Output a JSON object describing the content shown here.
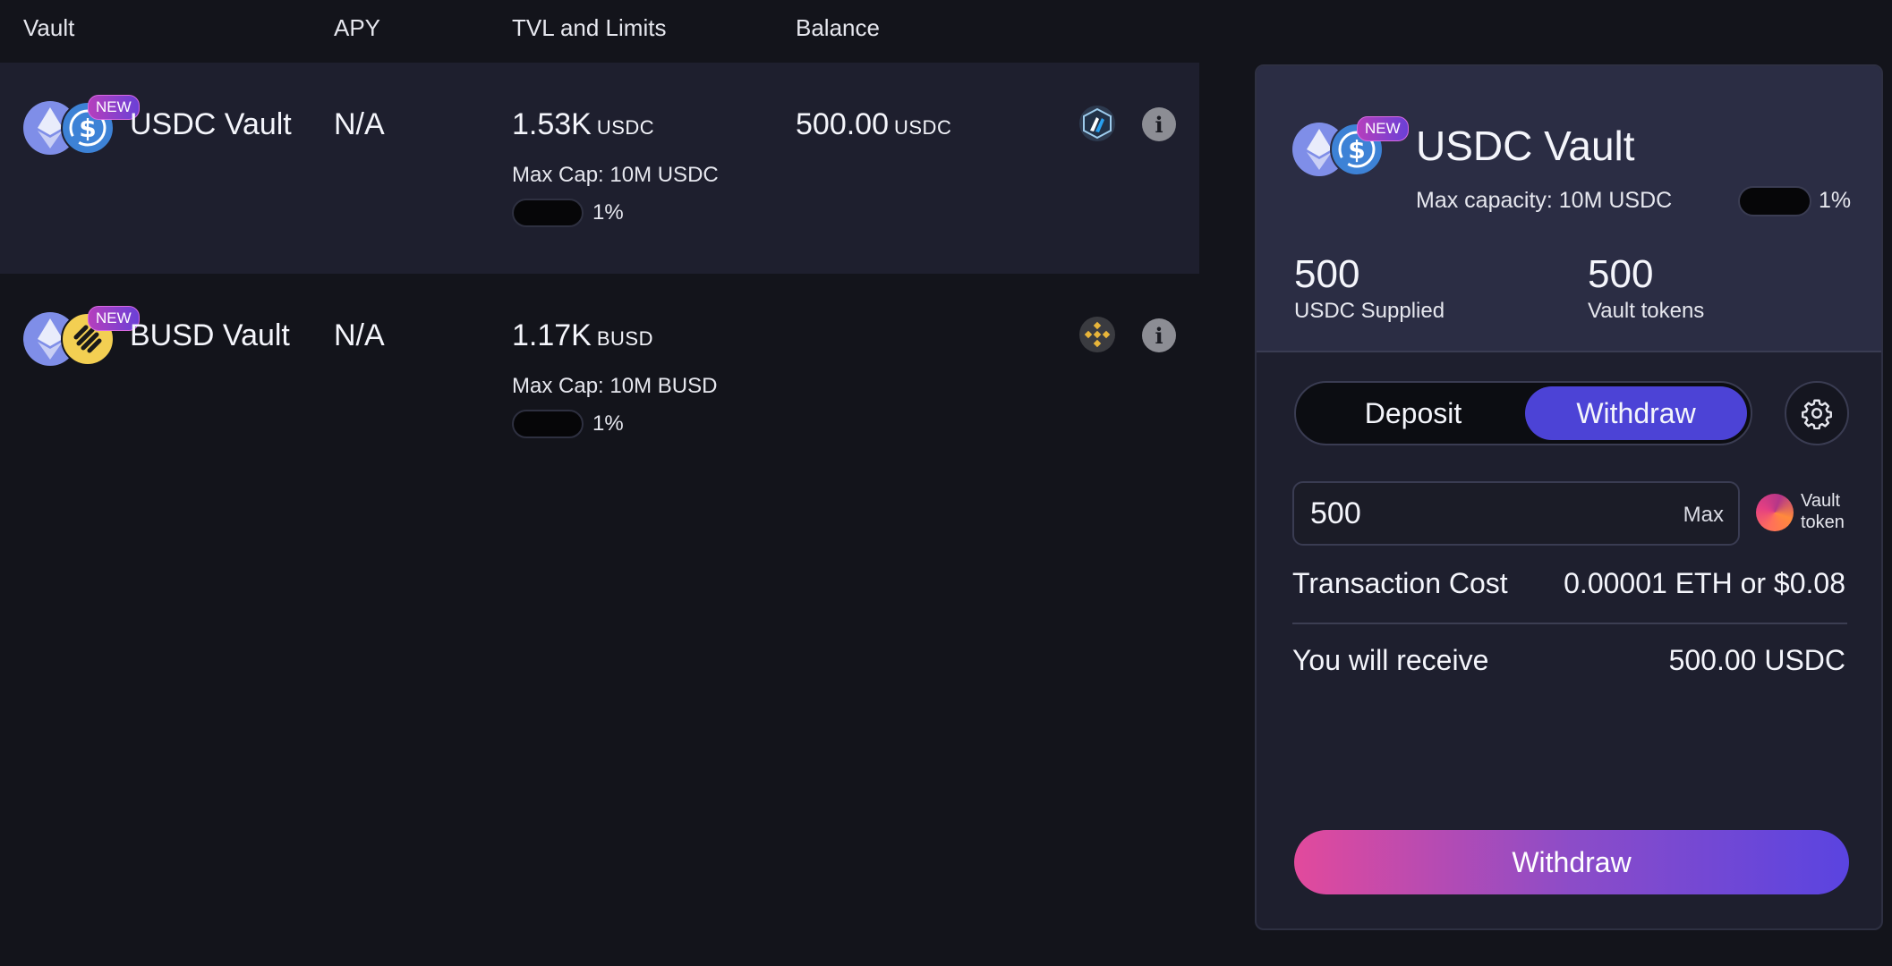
{
  "table": {
    "headers": {
      "vault": "Vault",
      "apy": "APY",
      "tvl": "TVL and Limits",
      "balance": "Balance"
    },
    "rows": [
      {
        "name": "USDC Vault",
        "badge": "NEW",
        "apy": "N/A",
        "tvl_value": "1.53K",
        "tvl_unit": "USDC",
        "max_cap": "Max Cap: 10M USDC",
        "fill_percent": "1%",
        "balance_value": "500.00",
        "balance_unit": "USDC",
        "coins": [
          "eth-icon",
          "usdc-icon"
        ],
        "chain_icon": "arbitrum-icon",
        "selected": true
      },
      {
        "name": "BUSD Vault",
        "badge": "NEW",
        "apy": "N/A",
        "tvl_value": "1.17K",
        "tvl_unit": "BUSD",
        "max_cap": "Max Cap: 10M BUSD",
        "fill_percent": "1%",
        "balance_value": "",
        "balance_unit": "",
        "coins": [
          "eth-icon",
          "busd-icon"
        ],
        "chain_icon": "bnb-icon",
        "selected": false
      }
    ]
  },
  "panel": {
    "title": "USDC Vault",
    "badge": "NEW",
    "max_capacity": "Max capacity: 10M USDC",
    "fill_percent": "1%",
    "supplied_value": "500",
    "supplied_label": "USDC Supplied",
    "tokens_value": "500",
    "tokens_label": "Vault tokens",
    "tabs": {
      "deposit": "Deposit",
      "withdraw": "Withdraw",
      "active": "withdraw"
    },
    "amount_value": "500",
    "max_label": "Max",
    "token_label_line1": "Vault",
    "token_label_line2": "token",
    "tx_cost_label": "Transaction Cost",
    "tx_cost_value": "0.00001 ETH or $0.08",
    "receive_label": "You will receive",
    "receive_value": "500.00 USDC",
    "cta_label": "Withdraw"
  },
  "colors": {
    "background": "#13141b",
    "selected_row": "#1e1f2e",
    "panel_top": "#2b2d44",
    "accent": "#4c43d6",
    "badge_gradient": [
      "#b53fbd",
      "#6a40d6"
    ],
    "cta_gradient": [
      "#e24a9c",
      "#5a44e0"
    ]
  }
}
